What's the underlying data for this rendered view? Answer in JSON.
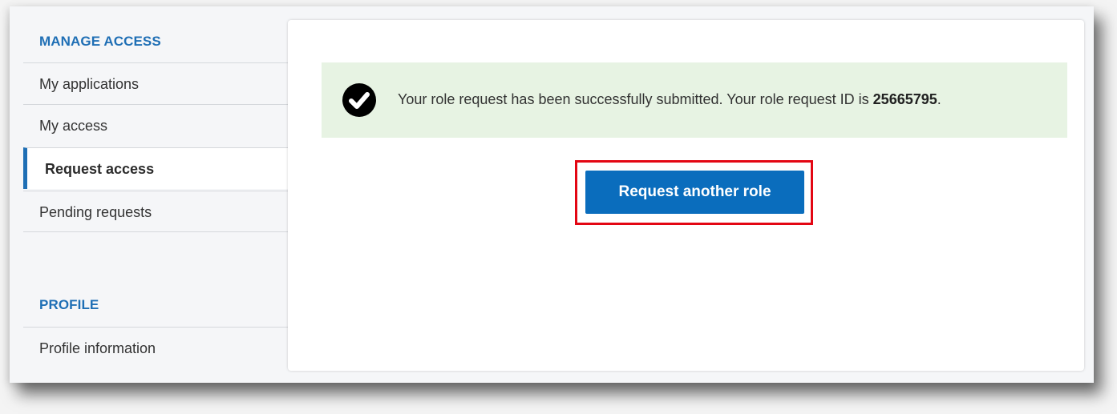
{
  "sidebar": {
    "manage_title": "MANAGE ACCESS",
    "items": [
      {
        "label": "My applications"
      },
      {
        "label": "My access"
      },
      {
        "label": "Request access"
      },
      {
        "label": "Pending requests"
      }
    ],
    "profile_title": "PROFILE",
    "profile_items": [
      {
        "label": "Profile information"
      }
    ]
  },
  "alert": {
    "icon": "check-circle-icon",
    "message_prefix": "Your role request has been successfully submitted. Your role request ID is ",
    "request_id": "25665795",
    "message_suffix": "."
  },
  "actions": {
    "request_another_label": "Request another role"
  },
  "colors": {
    "accent": "#1f6fb5",
    "button": "#0a6dbd",
    "success_bg": "#e7f3e3",
    "highlight": "#e30613"
  }
}
